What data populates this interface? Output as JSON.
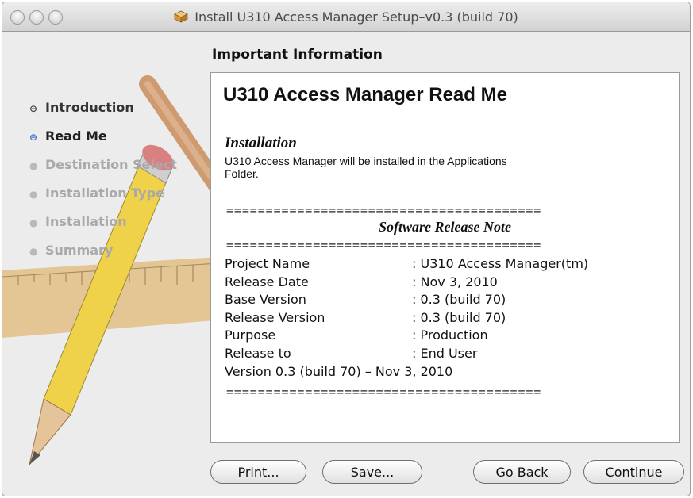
{
  "window": {
    "title": "Install U310 Access Manager Setup–v0.3 (build 70)"
  },
  "header": {
    "title": "Important Information"
  },
  "steps": [
    {
      "label": "Introduction",
      "state": "done"
    },
    {
      "label": "Read Me",
      "state": "current"
    },
    {
      "label": "Destination Select",
      "state": "future"
    },
    {
      "label": "Installation Type",
      "state": "future"
    },
    {
      "label": "Installation",
      "state": "future"
    },
    {
      "label": "Summary",
      "state": "future"
    }
  ],
  "readme": {
    "title": "U310 Access Manager Read Me",
    "installation_heading": "Installation",
    "installation_text": "U310 Access Manager will be installed in the Applications Folder.",
    "divider": "========================================",
    "release_heading": "Software Release Note",
    "rows": [
      {
        "key": "Project Name",
        "value": ": U310 Access Manager(tm)"
      },
      {
        "key": "Release Date",
        "value": ": Nov 3, 2010"
      },
      {
        "key": "Base Version",
        "value": ": 0.3 (build 70)"
      },
      {
        "key": "Release Version",
        "value": ": 0.3 (build 70)"
      },
      {
        "key": "Purpose",
        "value": ": Production"
      },
      {
        "key": "Release to",
        "value": ": End User"
      }
    ],
    "version_line": "Version 0.3 (build 70) – Nov 3, 2010"
  },
  "buttons": {
    "print": "Print...",
    "save": "Save...",
    "go_back": "Go Back",
    "continue": "Continue"
  },
  "colors": {
    "current_step_bullet": "#3f6fd0",
    "window_bg": "#ececec"
  }
}
